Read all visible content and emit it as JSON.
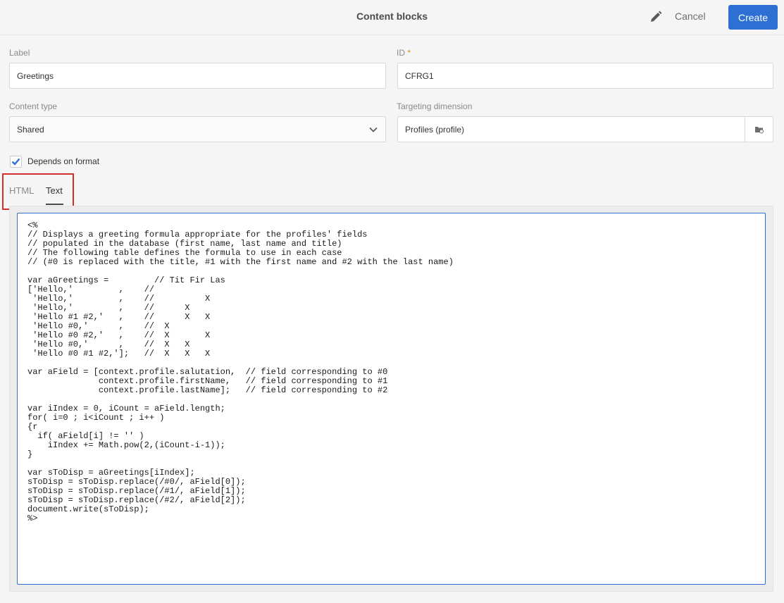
{
  "header": {
    "title": "Content blocks",
    "cancel_label": "Cancel",
    "create_label": "Create",
    "accent_color": "#2d6fd2"
  },
  "form": {
    "label": {
      "caption": "Label",
      "value": "Greetings"
    },
    "id": {
      "caption": "ID",
      "required_mark": "*",
      "value": "CFRG1"
    },
    "content_type": {
      "caption": "Content type",
      "value": "Shared"
    },
    "targeting": {
      "caption": "Targeting dimension",
      "value": "Profiles (profile)"
    },
    "depends_on_format": {
      "label": "Depends on format",
      "checked": true
    }
  },
  "tabs": [
    {
      "label": "HTML",
      "active": false
    },
    {
      "label": "Text",
      "active": true
    }
  ],
  "editor": {
    "code": "<%\n// Displays a greeting formula appropriate for the profiles' fields\n// populated in the database (first name, last name and title)\n// The following table defines the formula to use in each case\n// (#0 is replaced with the title, #1 with the first name and #2 with the last name)\n\nvar aGreetings =         // Tit Fir Las\n['Hello,'         ,    //\n 'Hello,'         ,    //          X\n 'Hello,'         ,    //      X\n 'Hello #1 #2,'   ,    //      X   X\n 'Hello #0,'      ,    //  X\n 'Hello #0 #2,'   ,    //  X       X\n 'Hello #0,'      ,    //  X   X\n 'Hello #0 #1 #2,'];   //  X   X   X\n\nvar aField = [context.profile.salutation,  // field corresponding to #0\n              context.profile.firstName,   // field corresponding to #1\n              context.profile.lastName];   // field corresponding to #2\n\nvar iIndex = 0, iCount = aField.length;\nfor( i=0 ; i<iCount ; i++ )\n{r\n  if( aField[i] != '' )\n    iIndex += Math.pow(2,(iCount-i-1));\n}\n\nvar sToDisp = aGreetings[iIndex];\nsToDisp = sToDisp.replace(/#0/, aField[0]);\nsToDisp = sToDisp.replace(/#1/, aField[1]);\nsToDisp = sToDisp.replace(/#2/, aField[2]);\ndocument.write(sToDisp);\n%>"
  },
  "icons": {
    "edit": "pencil-icon",
    "dropdown": "chevron-down-icon",
    "picker": "folder-picker-icon",
    "check": "checkmark-icon"
  },
  "highlight_color": "#d32f2f"
}
